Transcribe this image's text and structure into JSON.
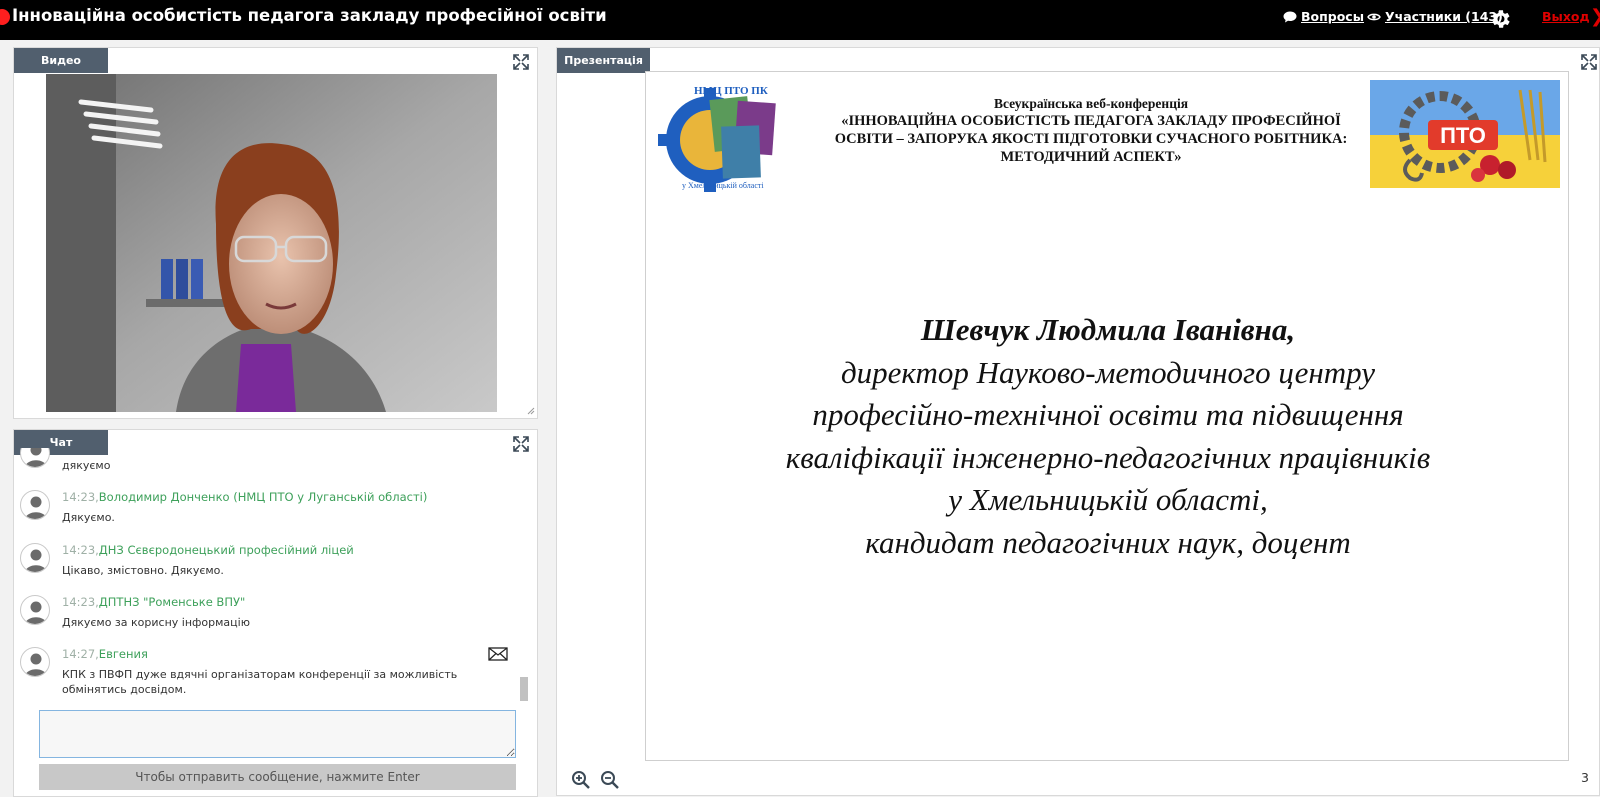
{
  "header": {
    "title": "Інноваційна особистість педагога закладу професійної освіти",
    "questions_label": "Вопросы",
    "participants_label": "Участники (143)",
    "exit_label": "Выход"
  },
  "video_panel": {
    "tab_label": "Видео"
  },
  "chat_panel": {
    "tab_label": "Чат",
    "messages": [
      {
        "time": "",
        "author": "",
        "text": "дякуємо"
      },
      {
        "time": "14:23,",
        "author": "Володимир Донченко (НМЦ ПТО у Луганській області)",
        "text": "Дякуємо."
      },
      {
        "time": "14:23,",
        "author": "ДНЗ Сєвєродонецький професійний ліцей",
        "text": "Цікаво, змістовно. Дякуємо."
      },
      {
        "time": "14:23,",
        "author": "ДПТНЗ \"Роменське ВПУ\"",
        "text": "Дякуємо за корисну інформацію"
      },
      {
        "time": "14:27,",
        "author": "Евгения",
        "text": "КПК з ПВФП дуже вдячні організаторам конференції за можливість обмінятись досвідом."
      }
    ],
    "input_value": "",
    "send_hint": "Чтобы отправить сообщение, нажмите Enter"
  },
  "presentation_panel": {
    "tab_label": "Презентація",
    "page_number": "3",
    "slide": {
      "logo_left_text": "НМЦ ПТО ПК",
      "logo_left_caption": "у Хмельницькій області",
      "logo_right_text": "ПТО",
      "header_line1": "Всеукраїнська веб-конференція",
      "header_line2": "«ІННОВАЦІЙНА ОСОБИСТІСТЬ ПЕДАГОГА ЗАКЛАДУ ПРОФЕСІЙНОЇ",
      "header_line3": "ОСВІТИ – ЗАПОРУКА ЯКОСТІ ПІДГОТОВКИ СУЧАСНОГО РОБІТНИКА:",
      "header_line4": "МЕТОДИЧНИЙ АСПЕКТ»",
      "speaker_name": "Шевчук Людмила Іванівна,",
      "role_line1": "директор Науково-методичного центру",
      "role_line2": "професійно-технічної освіти та підвищення",
      "role_line3": "кваліфікації інженерно-педагогічних працівників",
      "role_line4": "у Хмельницькій області,",
      "role_line5": "кандидат педагогічних наук, доцент"
    }
  },
  "colors": {
    "header_bg": "#000000",
    "tab_bg": "#515f6e",
    "exit": "#e00000",
    "chat_author": "#3da05a",
    "chat_time": "#9fb0a6"
  },
  "icons": [
    "record-dot-icon",
    "question-bubble-icon",
    "eye-icon",
    "gear-icon",
    "exit-arrow-icon",
    "expand-icon",
    "avatar-icon",
    "envelope-icon",
    "zoom-in-icon",
    "zoom-out-icon"
  ]
}
